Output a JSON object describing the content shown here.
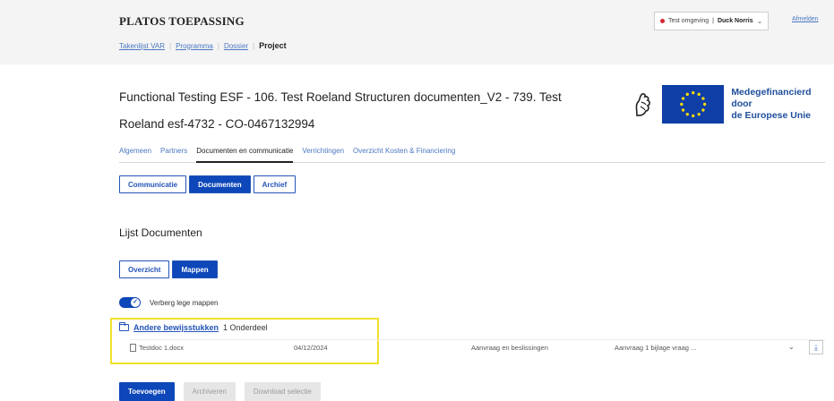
{
  "header": {
    "app_title": "PLATOS TOEPASSING",
    "environment": "Test omgeving",
    "user": "Duck Norris",
    "logout": "Afmelden"
  },
  "breadcrumb": [
    "Takenlijst VAR",
    "Programma",
    "Dossier"
  ],
  "breadcrumb_active": "Project",
  "project": {
    "title": "Functional Testing ESF - 106. Test Roeland Structuren documenten_V2 - 739. Test Roeland esf-4732 - CO-0467132994"
  },
  "logo": {
    "line1": "Medegefinancierd door",
    "line2": "de Europese Unie",
    "flag_color": "#0f3ea6",
    "star_color": "#f5d90a"
  },
  "tabs": [
    {
      "label": "Algemeen"
    },
    {
      "label": "Partners"
    },
    {
      "label": "Documenten en communicatie",
      "active": true
    },
    {
      "label": "Verrichtingen"
    },
    {
      "label": "Overzicht Kosten & Financiering"
    }
  ],
  "subtabs": {
    "communicatie": "Communicatie",
    "documenten": "Documenten",
    "archief": "Archief"
  },
  "section": {
    "title": "Lijst Documenten"
  },
  "view": {
    "overzicht": "Overzicht",
    "mappen": "Mappen"
  },
  "toggle": {
    "label": "Verberg lege mappen",
    "on": true
  },
  "folder": {
    "name": "Andere bewijsstukken",
    "count": "1 Onderdeel"
  },
  "file": {
    "name": "Testdoc 1.docx",
    "date": "04/12/2024",
    "category": "Aanvraag en beslissingen",
    "type": "Aanvraag 1 bijlage vraag ..."
  },
  "actions": {
    "add": "Toevoegen",
    "archive": "Archiveren",
    "download": "Download selectie"
  },
  "colors": {
    "primary": "#0d47b9",
    "link": "#4a78c2",
    "highlight": "#f0e22a",
    "env_dot": "#d6262f"
  }
}
